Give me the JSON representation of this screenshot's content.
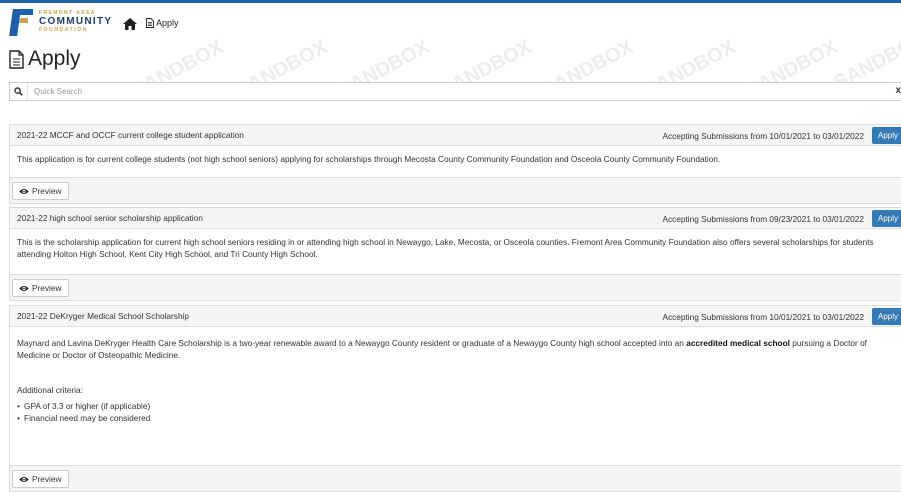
{
  "header": {
    "logo": {
      "line1": "FREMONT AREA",
      "line2": "COMMUNITY",
      "line3": "FOUNDATION"
    },
    "home_icon": "home-icon",
    "breadcrumb": "Apply",
    "accent_color": "#1f5fa7"
  },
  "page": {
    "title": "Apply"
  },
  "watermark": "SANDBOX",
  "search": {
    "placeholder": "Quick Search",
    "value": "",
    "clear_label": "x"
  },
  "opportunities": [
    {
      "title": "2021-22 MCCF and OCCF current college student application",
      "dates": "Accepting Submissions from 10/01/2021 to 03/01/2022",
      "apply_label": "Apply",
      "description": "This application is for current college students (not high school seniors) applying for scholarships through Mecosta County Community Foundation and Osceola County Community Foundation.",
      "preview_label": "Preview"
    },
    {
      "title": "2021-22 high school senior scholarship application",
      "dates": "Accepting Submissions from 09/23/2021 to 03/01/2022",
      "apply_label": "Apply",
      "description": "This is the scholarship application for current high school seniors residing in or attending high school in Newaygo, Lake, Mecosta, or Osceola counties. Fremont Area Community Foundation also offers several scholarships for students attending Holton High School, Kent City High School, and Tri County High School.",
      "preview_label": "Preview"
    },
    {
      "title": "2021-22 DeKryger Medical School Scholarship",
      "dates": "Accepting Submissions from 10/01/2021 to 03/01/2022",
      "apply_label": "Apply",
      "description_pre": "Maynard and Lavina DeKryger Health Care Scholarship is a two-year renewable award to a Newaygo County resident or graduate of a Newaygo County high school accepted into an ",
      "description_bold": "accredited medical school",
      "description_post": " pursuing a Doctor of Medicine or Doctor of Osteopathic Medicine.",
      "criteria_heading": "Additional criteria:",
      "criteria": [
        "GPA of 3.3 or higher (if applicable)",
        "Financial need may be considered"
      ],
      "preview_label": "Preview"
    }
  ]
}
